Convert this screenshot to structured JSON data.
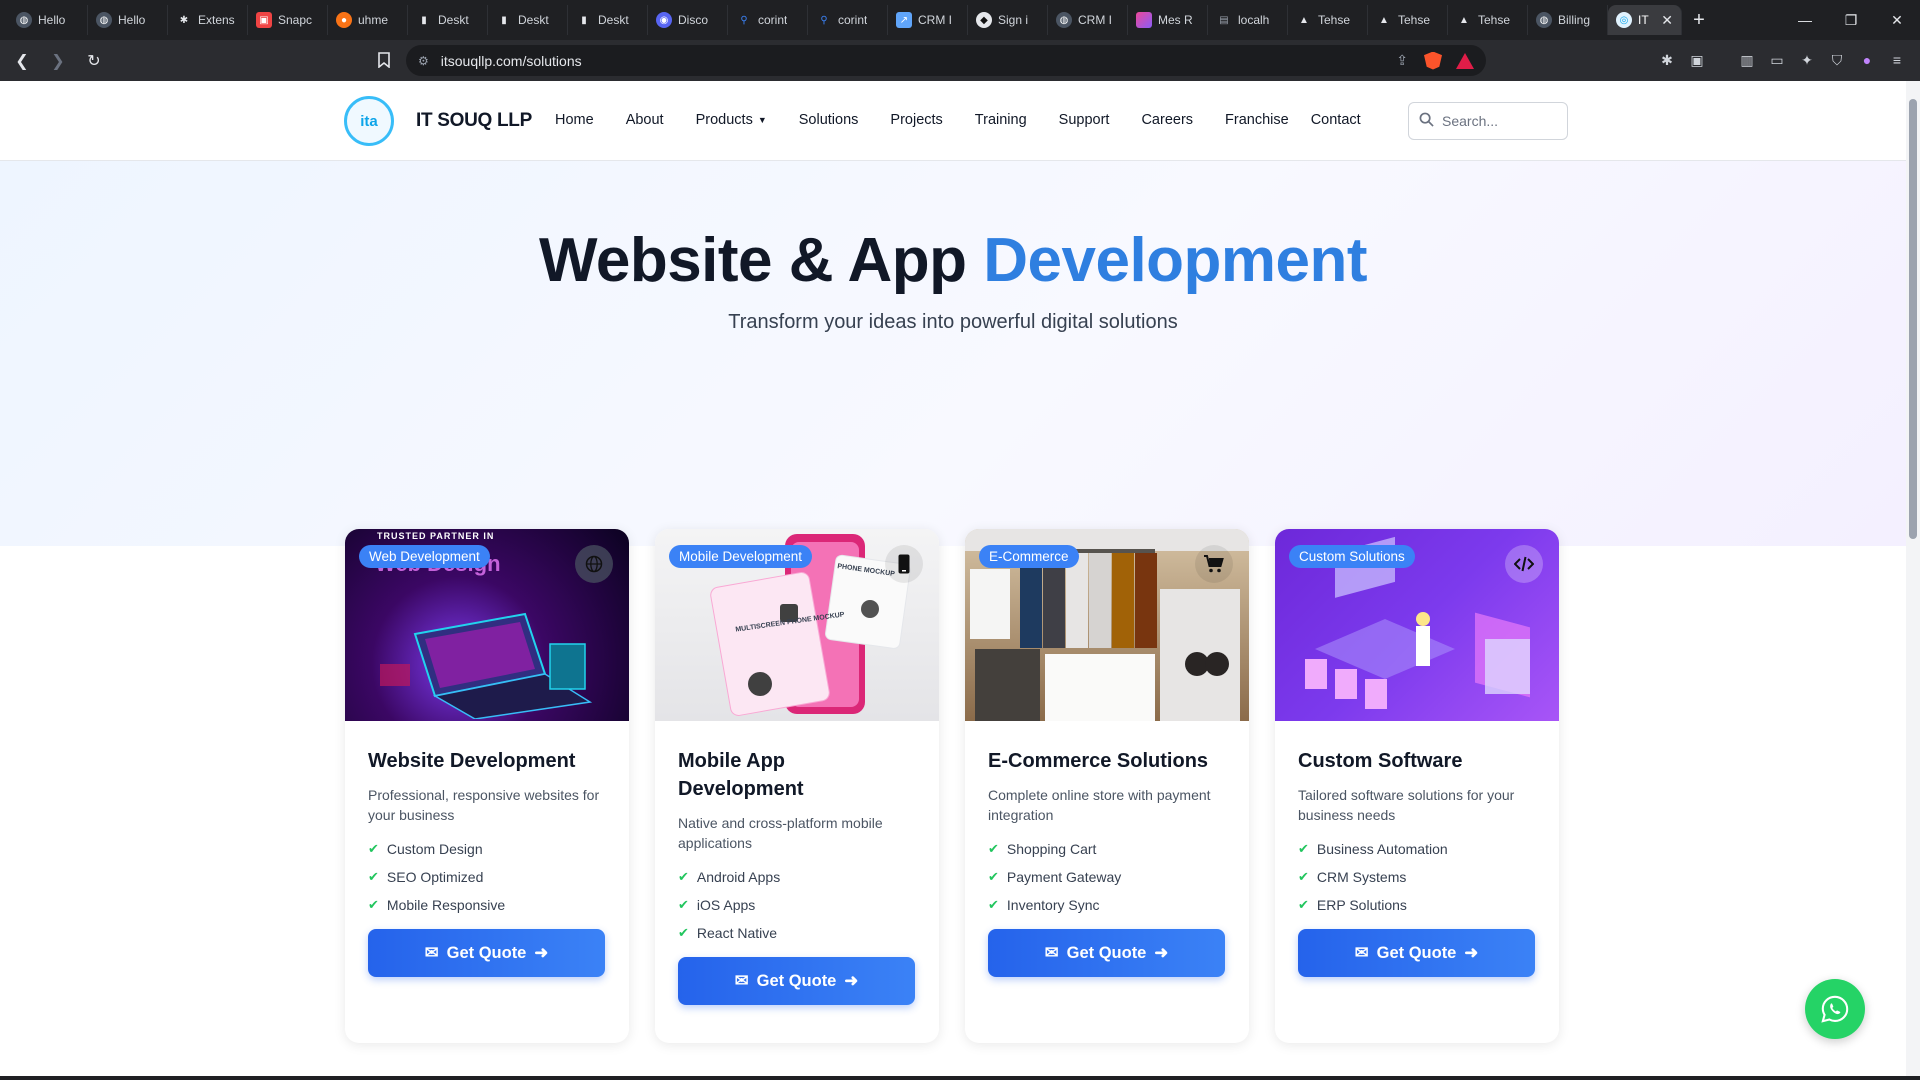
{
  "browser": {
    "tabs": [
      {
        "label": "Hello",
        "icon": "globe-icon",
        "color": "#9ca3af"
      },
      {
        "label": "Hello",
        "icon": "globe-icon",
        "color": "#9ca3af"
      },
      {
        "label": "Extens",
        "icon": "puzzle-icon",
        "color": "#9ca3af"
      },
      {
        "label": "Snapc",
        "icon": "image-icon",
        "color": "#ef4444"
      },
      {
        "label": "uhme",
        "icon": "circle-icon",
        "color": "#f97316"
      },
      {
        "label": "Deskt",
        "icon": "bars-icon",
        "color": "#e5e7eb"
      },
      {
        "label": "Deskt",
        "icon": "bars-icon",
        "color": "#e5e7eb"
      },
      {
        "label": "Deskt",
        "icon": "bars-icon",
        "color": "#e5e7eb"
      },
      {
        "label": "Disco",
        "icon": "discord-icon",
        "color": "#5865f2"
      },
      {
        "label": "corint",
        "icon": "search-icon",
        "color": "#3b82f6"
      },
      {
        "label": "corint",
        "icon": "search-icon",
        "color": "#3b82f6"
      },
      {
        "label": "CRM I",
        "icon": "chart-icon",
        "color": "#60a5fa"
      },
      {
        "label": "Sign i",
        "icon": "github-icon",
        "color": "#e5e7eb"
      },
      {
        "label": "CRM I",
        "icon": "globe-icon",
        "color": "#9ca3af"
      },
      {
        "label": "Mes R",
        "icon": "app-icon",
        "color": "#ec4899"
      },
      {
        "label": "localh",
        "icon": "folder-icon",
        "color": "#9ca3af"
      },
      {
        "label": "Tehse",
        "icon": "triangle-icon",
        "color": "#e5e7eb"
      },
      {
        "label": "Tehse",
        "icon": "triangle-icon",
        "color": "#e5e7eb"
      },
      {
        "label": "Tehse",
        "icon": "triangle-icon",
        "color": "#e5e7eb"
      },
      {
        "label": "Billing",
        "icon": "globe-icon",
        "color": "#9ca3af"
      }
    ],
    "active_tab": {
      "label": "IT",
      "close": "✕"
    },
    "new_tab": "+",
    "url": "itsouqllp.com/solutions"
  },
  "site": {
    "logo_text": "ita",
    "brand": "IT SOUQ LLP",
    "nav": {
      "home": "Home",
      "about": "About",
      "products": "Products",
      "solutions": "Solutions",
      "projects": "Projects",
      "training": "Training",
      "support": "Support",
      "careers": "Careers",
      "franchise": "Franchise",
      "contact": "Contact"
    },
    "search_placeholder": "Search..."
  },
  "hero": {
    "title_main": "Website & App",
    "title_accent": "Development",
    "subtitle": "Transform your ideas into powerful digital solutions",
    "accent_color": "#2f7fe0"
  },
  "cards": [
    {
      "badge": "Web Development",
      "icon": "globe-icon",
      "image_caption": "TRUSTED PARTNER IN",
      "image_headline": "Web Design",
      "title": "Website Development",
      "desc": "Professional, responsive websites for your business",
      "features": [
        "Custom Design",
        "SEO Optimized",
        "Mobile Responsive"
      ],
      "cta": "Get Quote"
    },
    {
      "badge": "Mobile Development",
      "icon": "mobile-icon",
      "image_caption": "PHONE MOCKUP",
      "image_headline": "MULTISCREEN PHONE MOCKUP",
      "title": "Mobile App Development",
      "desc": "Native and cross-platform mobile applications",
      "features": [
        "Android Apps",
        "iOS Apps",
        "React Native"
      ],
      "cta": "Get Quote"
    },
    {
      "badge": "E-Commerce",
      "icon": "cart-icon",
      "title": "E-Commerce Solutions",
      "desc": "Complete online store with payment integration",
      "features": [
        "Shopping Cart",
        "Payment Gateway",
        "Inventory Sync"
      ],
      "cta": "Get Quote"
    },
    {
      "badge": "Custom Solutions",
      "icon": "code-icon",
      "title": "Custom Software",
      "desc": "Tailored software solutions for your business needs",
      "features": [
        "Business Automation",
        "CRM Systems",
        "ERP Solutions"
      ],
      "cta": "Get Quote"
    }
  ],
  "colors": {
    "primary": "#3b82f6",
    "check": "#22c55e",
    "whatsapp": "#25d366"
  }
}
